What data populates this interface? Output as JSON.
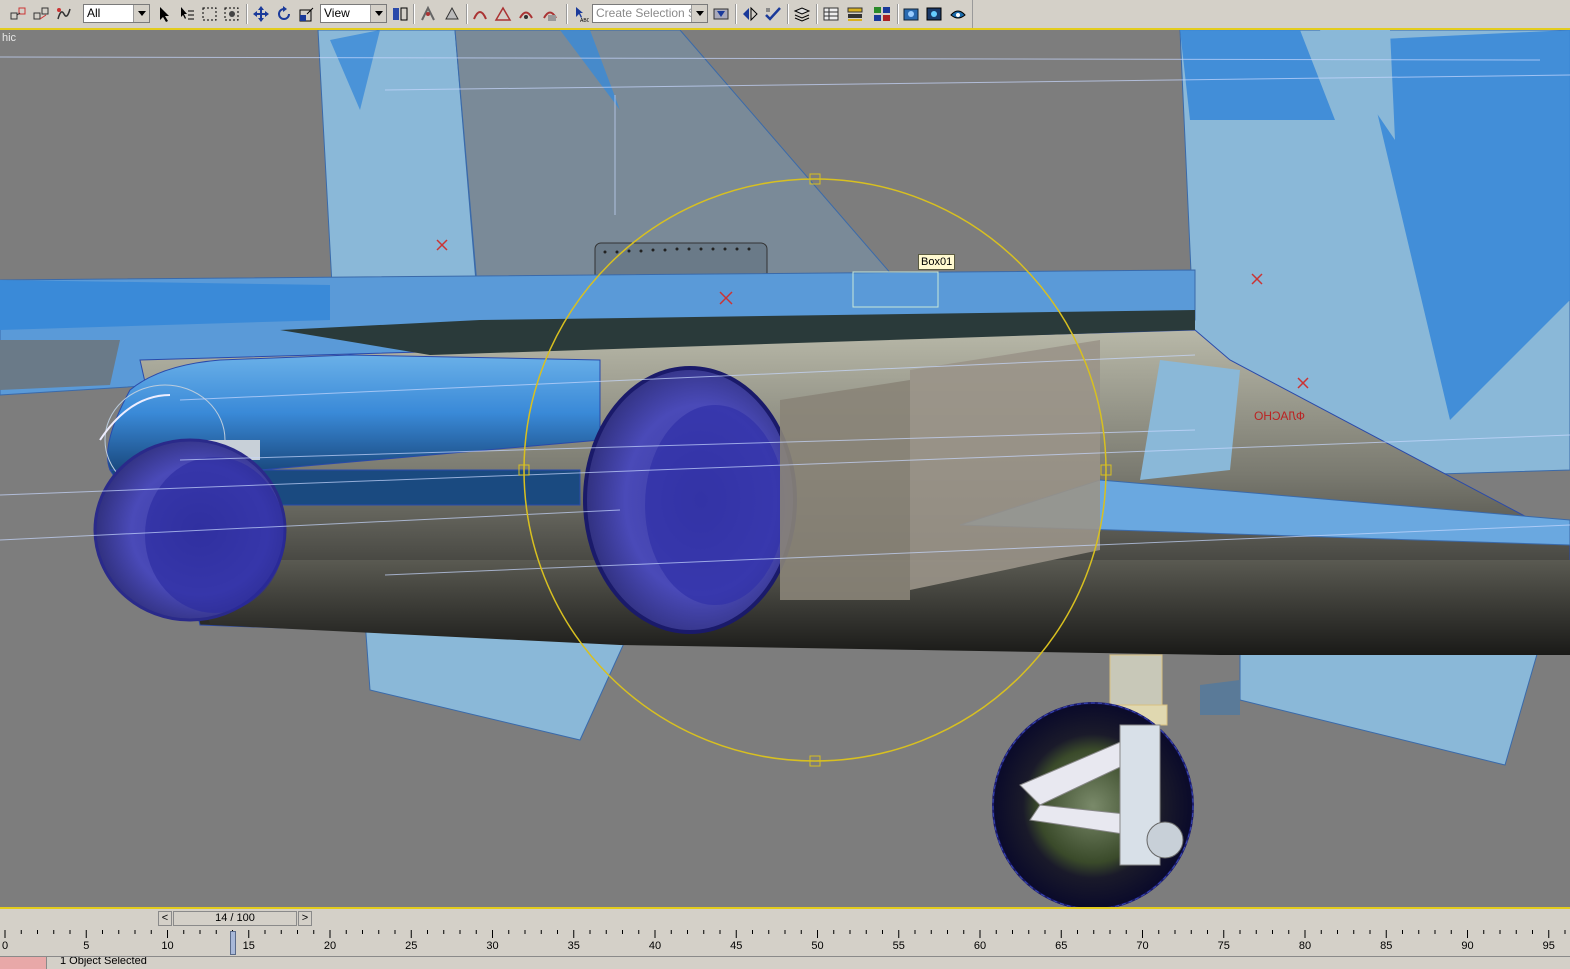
{
  "toolbar": {
    "filter_value": "All",
    "refcoord_value": "View",
    "selection_set_placeholder": "Create Selection Set",
    "icons": [
      "select-link-icon",
      "unlink-icon",
      "bind-space-warp-icon",
      "select-object-icon",
      "select-by-name-icon",
      "rect-selection-icon",
      "window-crossing-icon",
      "move-icon",
      "rotate-icon",
      "scale-icon",
      "pivot-icon",
      "snap-toggle-icon",
      "angle-snap-icon",
      "percent-snap-icon",
      "spinner-snap-icon",
      "named-selection-icon",
      "mirror-icon",
      "align-icon",
      "layer-manager-icon",
      "curve-editor-icon",
      "schematic-view-icon",
      "material-editor-icon",
      "render-scene-icon",
      "quick-render-icon",
      "activeshade-icon"
    ]
  },
  "viewport": {
    "label": "hic",
    "object_label": "Box01",
    "fuselage_text": "ФЛАСНО"
  },
  "timeline": {
    "slider_text": "14 / 100",
    "prev": "<",
    "next": ">",
    "ticks": [
      "0",
      "5",
      "10",
      "15",
      "20",
      "25",
      "30",
      "35",
      "40",
      "45",
      "50",
      "55",
      "60",
      "65",
      "70",
      "75",
      "80",
      "85",
      "90",
      "95"
    ],
    "current_frame": 14,
    "total_frames": 100
  },
  "status": {
    "text": "1 Object Selected"
  },
  "colors": {
    "viewport_bg": "#7d7d7d",
    "ui_bg": "#d4d0c8",
    "active_border": "#e3cc1c",
    "gizmo": "#d8c020"
  }
}
